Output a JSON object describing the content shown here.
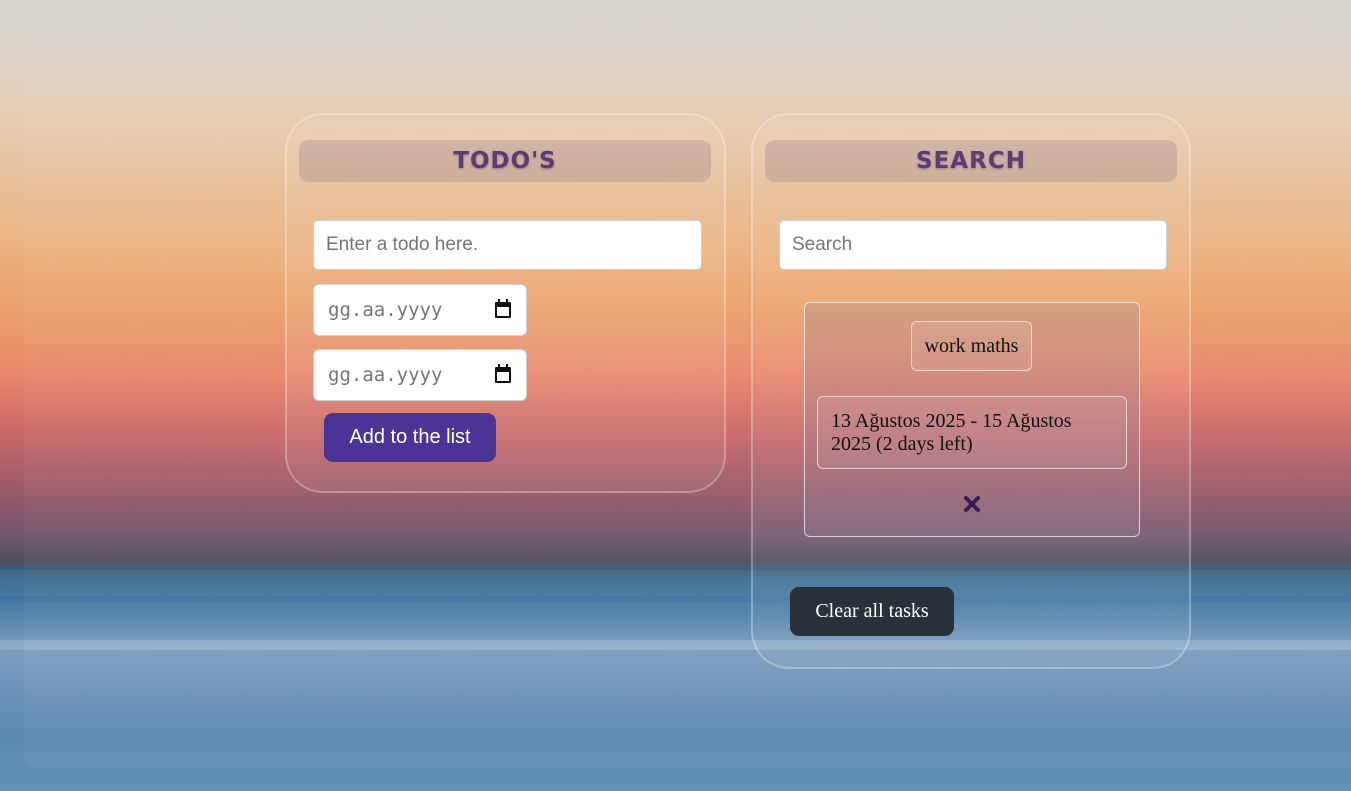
{
  "todos_panel": {
    "title": "TODO'S",
    "todo_input": {
      "placeholder": "Enter a todo here.",
      "value": ""
    },
    "start_date": {
      "placeholder": "gg.aa.yyyy"
    },
    "end_date": {
      "placeholder": "gg.aa.yyyy"
    },
    "add_button_label": "Add to the list"
  },
  "search_panel": {
    "title": "SEARCH",
    "search_input": {
      "placeholder": "Search",
      "value": ""
    },
    "tasks": [
      {
        "title": "work maths",
        "dates": "13 Ağustos 2025 - 15 Ağustos 2025 (2 days left)",
        "delete_icon": "close-x-icon"
      }
    ],
    "clear_button_label": "Clear all tasks"
  },
  "colors": {
    "header_text": "#5b3d75",
    "add_button": "#4a3496",
    "clear_button": "#2b3138",
    "delete_icon": "#3b1a55"
  }
}
